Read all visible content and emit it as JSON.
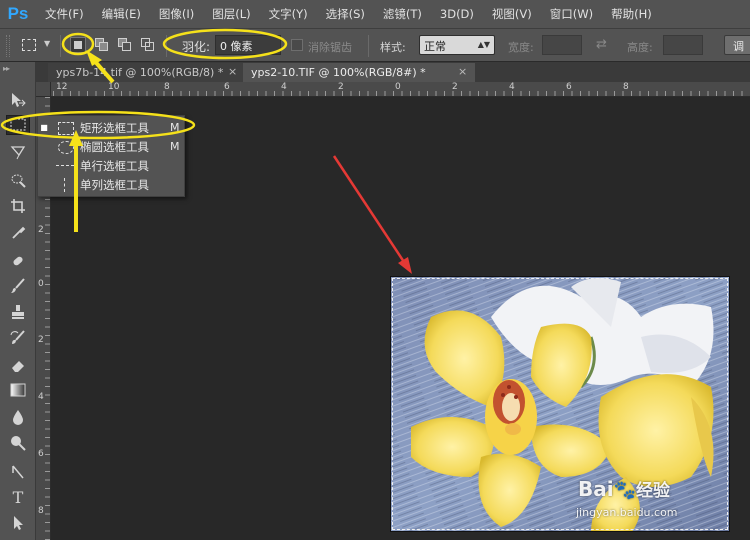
{
  "app": {
    "logo": "Ps",
    "menu": [
      "文件(F)",
      "编辑(E)",
      "图像(I)",
      "图层(L)",
      "文字(Y)",
      "选择(S)",
      "滤镜(T)",
      "3D(D)",
      "视图(V)",
      "窗口(W)",
      "帮助(H)"
    ]
  },
  "options": {
    "tool_icon": "rect-marquee-icon",
    "feather_label": "羽化:",
    "feather_value": "0 像素",
    "antialias_label": "消除锯齿",
    "style_label": "样式:",
    "style_value": "正常",
    "width_label": "宽度:",
    "height_label": "高度:",
    "refine_label": "调"
  },
  "tabs": [
    {
      "title": "yps7b-14.tif @ 100%(RGB/8) *",
      "active": false
    },
    {
      "title": "yps2-10.TIF @ 100%(RGB/8#) *",
      "active": true
    }
  ],
  "rulers": {
    "top": [
      "12",
      "10",
      "8",
      "6",
      "4",
      "2",
      "0",
      "2",
      "4",
      "6",
      "8"
    ],
    "left": [
      "2",
      "0",
      "2",
      "4",
      "6",
      "8"
    ]
  },
  "flyout": [
    {
      "label": "矩形选框工具",
      "shortcut": "M",
      "icon": "rect-marquee-icon",
      "current": true
    },
    {
      "label": "椭圆选框工具",
      "shortcut": "M",
      "icon": "ellipse-marquee-icon",
      "current": false
    },
    {
      "label": "单行选框工具",
      "shortcut": "",
      "icon": "single-row-marquee-icon",
      "current": false
    },
    {
      "label": "单列选框工具",
      "shortcut": "",
      "icon": "single-column-marquee-icon",
      "current": false
    }
  ],
  "tools": [
    "move-icon",
    "marquee-icon",
    "lasso-icon",
    "quick-select-icon",
    "crop-icon",
    "eyedropper-icon",
    "healing-icon",
    "brush-icon",
    "stamp-icon",
    "history-brush-icon",
    "eraser-icon",
    "gradient-icon",
    "blur-icon",
    "dodge-icon",
    "pen-icon",
    "type-icon",
    "path-select-icon"
  ],
  "annotations": {
    "highlight_color": "#f5e11a",
    "arrow_color": "#e53935"
  },
  "watermark": {
    "brand": "Bai",
    "brand2": "经验",
    "url": "jingyan.baidu.com"
  }
}
